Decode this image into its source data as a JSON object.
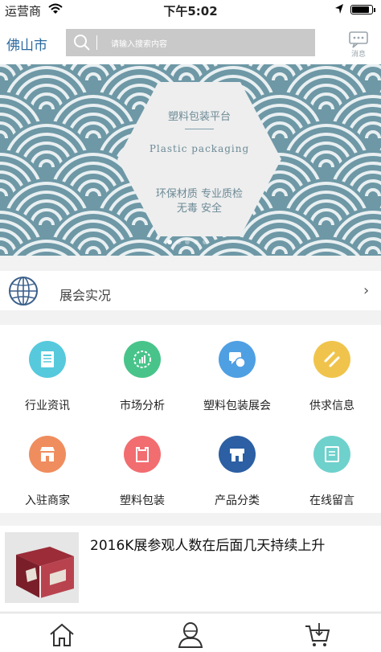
{
  "status_bar": {
    "carrier": "运营商",
    "time": "下午5:02",
    "battery_level": 0.9
  },
  "header": {
    "city": "佛山市",
    "search_placeholder": "请输入搜索内容",
    "message_label": "消息",
    "icons": [
      "search-icon",
      "message-icon"
    ]
  },
  "banner": {
    "title": "塑料包装平台",
    "subtitle": "Plastic packaging",
    "features_line1": "环保材质  专业质检",
    "features_line2": "无毒  安全",
    "page_count": 5,
    "active_page": 0,
    "colors": {
      "background": "#6e98a6",
      "wave": "#ffffff",
      "hexagon": "#eeeeee"
    }
  },
  "expo": {
    "label": "展会实况",
    "icon": "globe-icon",
    "arrow": "›"
  },
  "categories": [
    {
      "label": "行业资讯",
      "icon": "news-icon",
      "color": "#56c9dd"
    },
    {
      "label": "市场分析",
      "icon": "chart-icon",
      "color": "#48c48a"
    },
    {
      "label": "塑料包装展会",
      "icon": "chat-icon",
      "color": "#4f9fe3"
    },
    {
      "label": "供求信息",
      "icon": "exchange-icon",
      "color": "#f0c44c"
    },
    {
      "label": "入驻商家",
      "icon": "store-icon",
      "color": "#ef8d5e"
    },
    {
      "label": "塑料包装",
      "icon": "bag-icon",
      "color": "#f26d70"
    },
    {
      "label": "产品分类",
      "icon": "shop-icon",
      "color": "#2c5fa3"
    },
    {
      "label": "在线留言",
      "icon": "note-icon",
      "color": "#6fd1cc"
    }
  ],
  "news": [
    {
      "title": "2016K展参观人数在后面几天持续上升",
      "thumbnail": "gift-box-image"
    }
  ],
  "tabbar": {
    "tabs": [
      "home-icon",
      "user-icon",
      "cart-icon"
    ]
  }
}
